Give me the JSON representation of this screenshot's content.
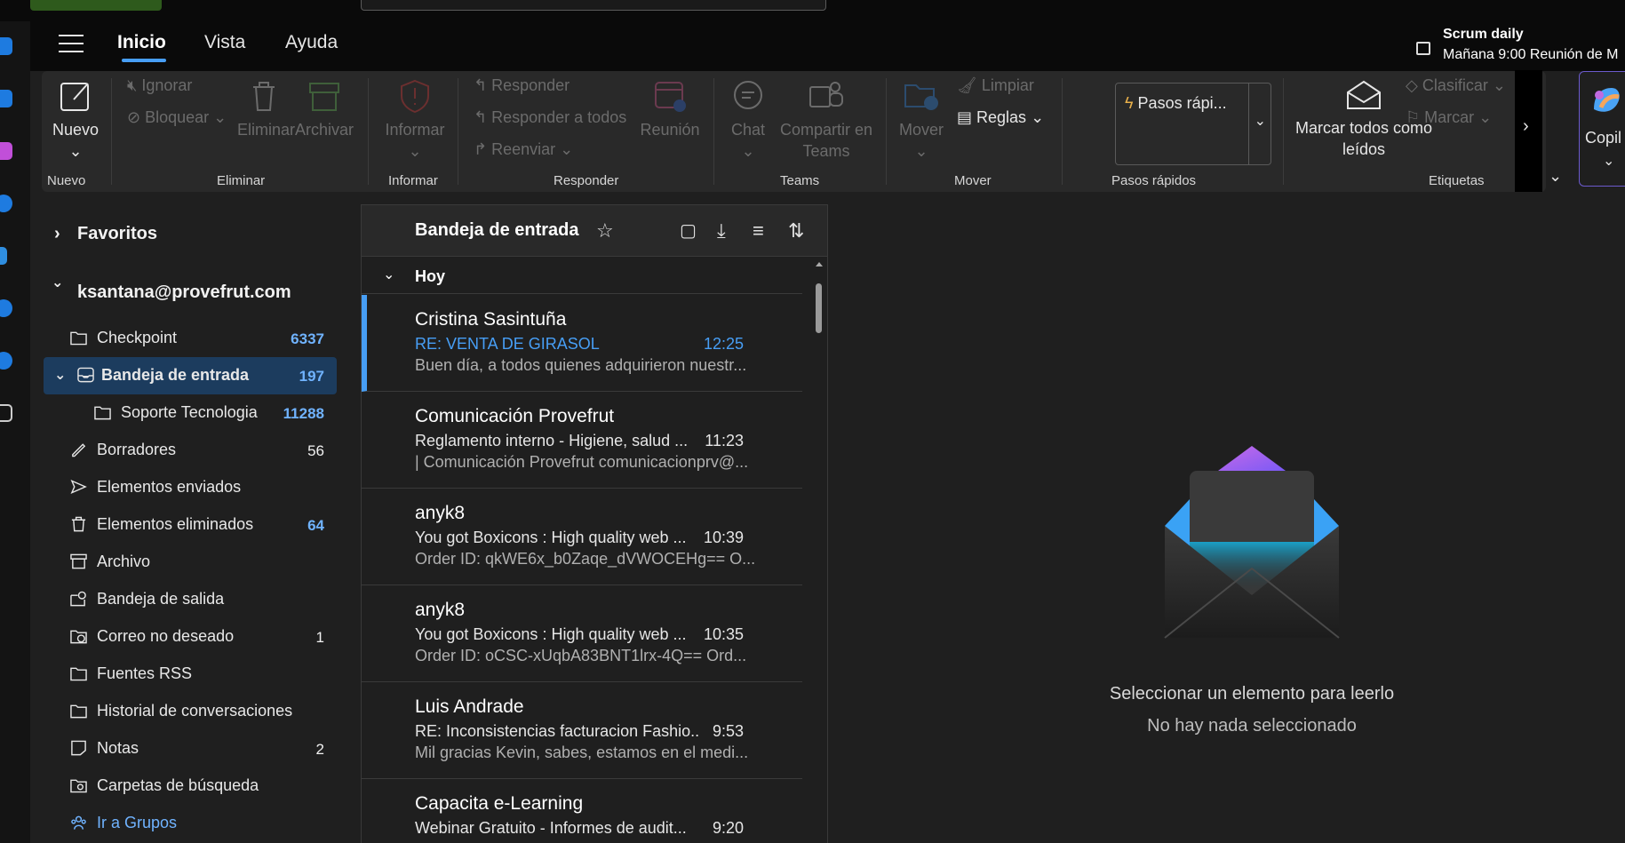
{
  "header": {
    "tabs": [
      {
        "label": "Inicio"
      },
      {
        "label": "Vista"
      },
      {
        "label": "Ayuda"
      }
    ],
    "reminder": {
      "title": "Scrum daily",
      "subtitle": "Mañana 9:00 Reunión de M"
    }
  },
  "ribbon": {
    "nuevo": {
      "label": "Nuevo",
      "group": "Nuevo"
    },
    "eliminar": {
      "group": "Eliminar",
      "ignorar": "Ignorar",
      "bloquear": "Bloquear",
      "eliminar": "Eliminar",
      "archivar": "Archivar"
    },
    "informar": {
      "label": "Informar",
      "group": "Informar"
    },
    "responder": {
      "group": "Responder",
      "responder": "Responder",
      "responder_todos": "Responder a todos",
      "reenviar": "Reenviar",
      "reunion": "Reunión"
    },
    "teams": {
      "group": "Teams",
      "chat": "Chat",
      "compartir_1": "Compartir en",
      "compartir_2": "Teams"
    },
    "mover": {
      "group": "Mover",
      "mover": "Mover",
      "limpiar": "Limpiar",
      "reglas": "Reglas"
    },
    "pasos": {
      "group": "Pasos rápidos",
      "value": "Pasos rápi..."
    },
    "marcar_leidos": {
      "line1": "Marcar todos como",
      "line2": "leídos"
    },
    "etiquetas": {
      "group": "Etiquetas",
      "clasificar": "Clasificar",
      "marcar": "Marcar"
    },
    "copilot": "Copil"
  },
  "folders": {
    "favoritos": "Favoritos",
    "account": "ksantana@provefrut.com",
    "items": [
      {
        "label": "Checkpoint",
        "count": "6337",
        "icon": "folder-icon"
      },
      {
        "label": "Bandeja de entrada",
        "count": "197",
        "icon": "inbox-icon"
      },
      {
        "label": "Soporte Tecnologia",
        "count": "11288",
        "icon": "folder-icon"
      },
      {
        "label": "Borradores",
        "count": "56",
        "icon": "draft-icon"
      },
      {
        "label": "Elementos enviados",
        "count": "",
        "icon": "send-icon"
      },
      {
        "label": "Elementos eliminados",
        "count": "64",
        "icon": "trash-icon"
      },
      {
        "label": "Archivo",
        "count": "",
        "icon": "archive-icon"
      },
      {
        "label": "Bandeja de salida",
        "count": "",
        "icon": "outbox-icon"
      },
      {
        "label": "Correo no deseado",
        "count": "1",
        "icon": "junk-icon"
      },
      {
        "label": "Fuentes RSS",
        "count": "",
        "icon": "folder-icon"
      },
      {
        "label": "Historial de conversaciones",
        "count": "",
        "icon": "folder-icon"
      },
      {
        "label": "Notas",
        "count": "2",
        "icon": "note-icon"
      },
      {
        "label": "Carpetas de búsqueda",
        "count": "",
        "icon": "search-folder-icon"
      },
      {
        "label": "Ir a Grupos",
        "count": "",
        "icon": "groups-icon"
      }
    ]
  },
  "list": {
    "title": "Bandeja de entrada",
    "group": "Hoy",
    "messages": [
      {
        "sender": "Cristina Sasintuña",
        "subject": "RE: VENTA DE GIRASOL",
        "time": "12:25",
        "preview": "Buen día, a todos quienes adquirieron nuestr..."
      },
      {
        "sender": "Comunicación Provefrut",
        "subject": "Reglamento interno - Higiene, salud ...",
        "time": "11:23",
        "preview": "| Comunicación Provefrut comunicacionprv@..."
      },
      {
        "sender": "anyk8",
        "subject": "You got Boxicons : High quality web ...",
        "time": "10:39",
        "preview": "Order ID: qkWE6x_b0Zaqe_dVWOCEHg== O..."
      },
      {
        "sender": "anyk8",
        "subject": "You got Boxicons : High quality web ...",
        "time": "10:35",
        "preview": "Order ID: oCSC-xUqbA83BNT1lrx-4Q== Ord..."
      },
      {
        "sender": "Luis Andrade",
        "subject": "RE: Inconsistencias facturacion Fashio...",
        "time": "9:53",
        "preview": "Mil gracias Kevin, sabes, estamos en el medi..."
      },
      {
        "sender": "Capacita e-Learning",
        "subject": "Webinar Gratuito - Informes de audit...",
        "time": "9:20",
        "preview": ""
      }
    ]
  },
  "reading": {
    "title": "Seleccionar un elemento para leerlo",
    "subtitle": "No hay nada seleccionado"
  },
  "colors": {
    "accent": "#479ef5",
    "selected_folder": "#1c3c5e",
    "count_blue": "#70b3ff"
  }
}
